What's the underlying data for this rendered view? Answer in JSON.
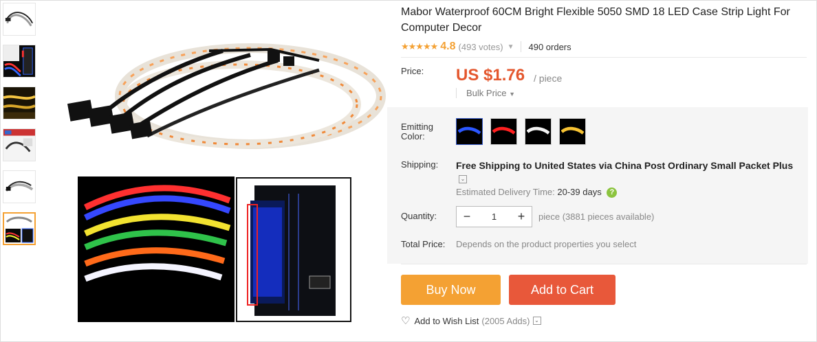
{
  "product": {
    "title": "Mabor Waterproof 60CM Bright Flexible 5050 SMD 18 LED Case Strip Light For Computer Decor",
    "rating": "4.8",
    "votes": "(493 votes)",
    "orders": "490 orders"
  },
  "price": {
    "label": "Price:",
    "value": "US $1.76",
    "unit": "/ piece",
    "bulk": "Bulk Price"
  },
  "color": {
    "label": "Emitting Color:",
    "options": [
      "blue",
      "red",
      "white",
      "yellow"
    ],
    "hex": [
      "#2b57ff",
      "#ff2020",
      "#f2f2f2",
      "#f6c233"
    ],
    "selected": "blue"
  },
  "shipping": {
    "label": "Shipping:",
    "prefix": "Free Shipping to",
    "destination": "United States via China Post Ordinary Small Packet Plus",
    "estimate_label": "Estimated Delivery Time:",
    "estimate_days": "20-39 days"
  },
  "quantity": {
    "label": "Quantity:",
    "value": "1",
    "minus": "−",
    "plus": "+",
    "available": "piece (3881 pieces available)"
  },
  "total": {
    "label": "Total Price:",
    "value": "Depends on the product properties you select"
  },
  "actions": {
    "buy_now": "Buy Now",
    "add_to_cart": "Add to Cart",
    "wishlist": "Add to Wish List",
    "wishlist_count": "(2005 Adds)"
  },
  "colors": {
    "accent_orange": "#f4a133",
    "cart_red": "#e8583a",
    "price_red": "#e4572e"
  },
  "icons": [
    "star-icon",
    "chevron-down-icon",
    "question-icon",
    "heart-plus-icon",
    "minus-icon",
    "plus-icon"
  ]
}
